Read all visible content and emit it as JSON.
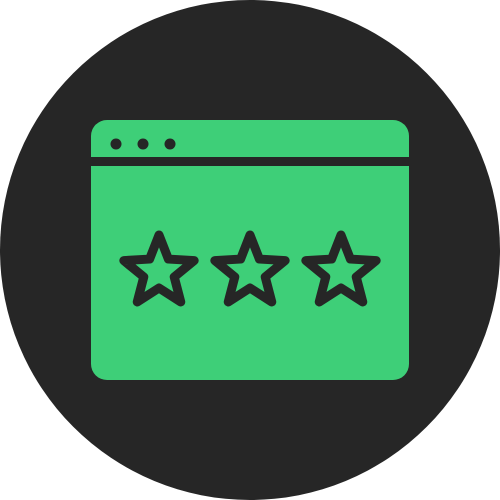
{
  "icon": {
    "name": "website-rating-icon",
    "background_shape": "circle",
    "window_dot_count": 3,
    "star_count": 3,
    "stars_filled_ratio": 1.0
  },
  "colors": {
    "circle": "#262626",
    "window_fill": "#3ecf78",
    "stroke": "#262626",
    "page_background": "#ffffff"
  }
}
